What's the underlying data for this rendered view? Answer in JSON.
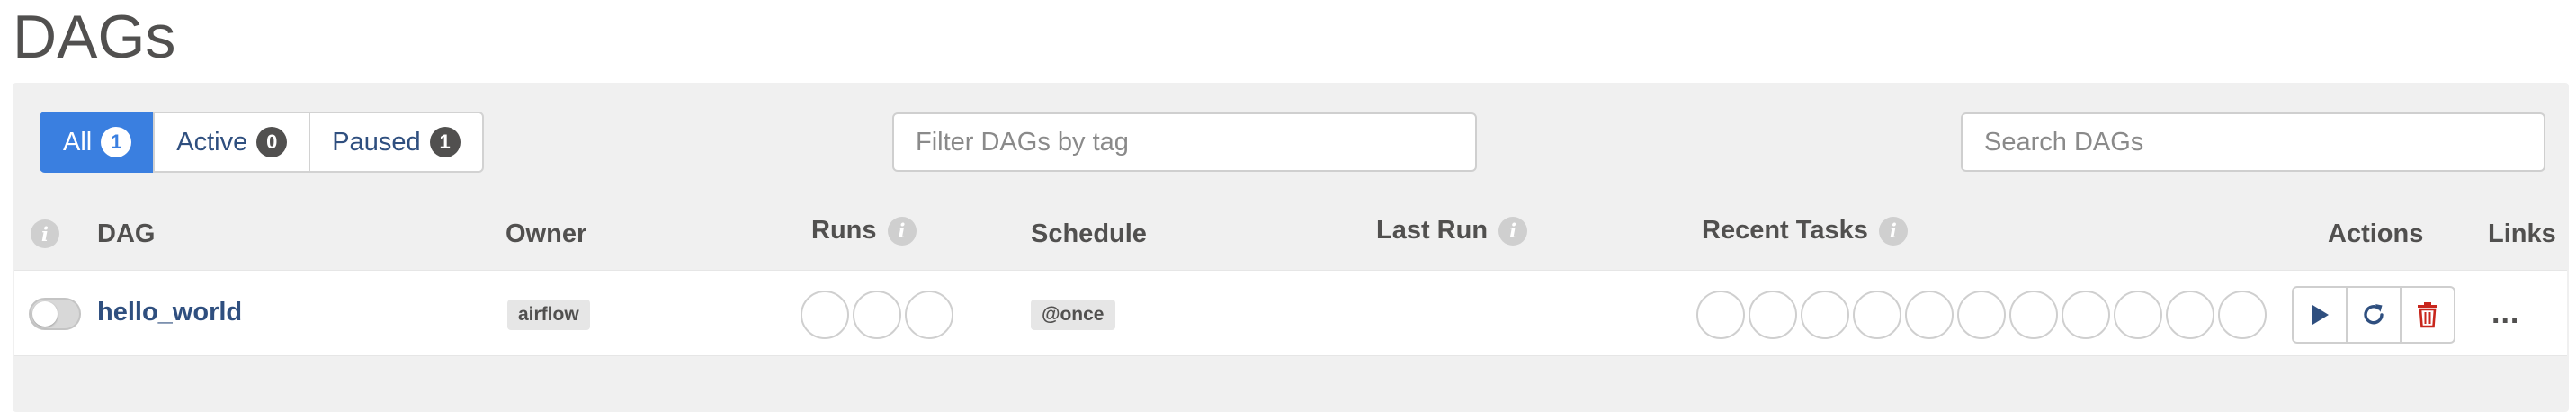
{
  "page": {
    "title": "DAGs"
  },
  "filters": {
    "all": {
      "label": "All",
      "count": "1"
    },
    "active": {
      "label": "Active",
      "count": "0"
    },
    "paused": {
      "label": "Paused",
      "count": "1"
    }
  },
  "tag_filter": {
    "placeholder": "Filter DAGs by tag",
    "value": ""
  },
  "search": {
    "placeholder": "Search DAGs",
    "value": ""
  },
  "columns": {
    "dag": "DAG",
    "owner": "Owner",
    "runs": "Runs",
    "schedule": "Schedule",
    "last_run": "Last Run",
    "recent_tasks": "Recent Tasks",
    "actions": "Actions",
    "links": "Links"
  },
  "rows": [
    {
      "dag_id": "hello_world",
      "owner": "airflow",
      "schedule": "@once",
      "last_run": "",
      "paused": true,
      "run_circles": 3,
      "task_circles": 11
    }
  ],
  "row_links": {
    "more": "..."
  },
  "colors": {
    "accent": "#3a7fe0",
    "link": "#2f4f7f",
    "delete": "#c8261c",
    "text": "#51504f",
    "panel": "#f0f0f0"
  },
  "icons": {
    "info": "info-icon",
    "trigger": "play-icon",
    "refresh": "refresh-icon",
    "delete": "trash-icon",
    "more": "ellipsis-icon"
  }
}
